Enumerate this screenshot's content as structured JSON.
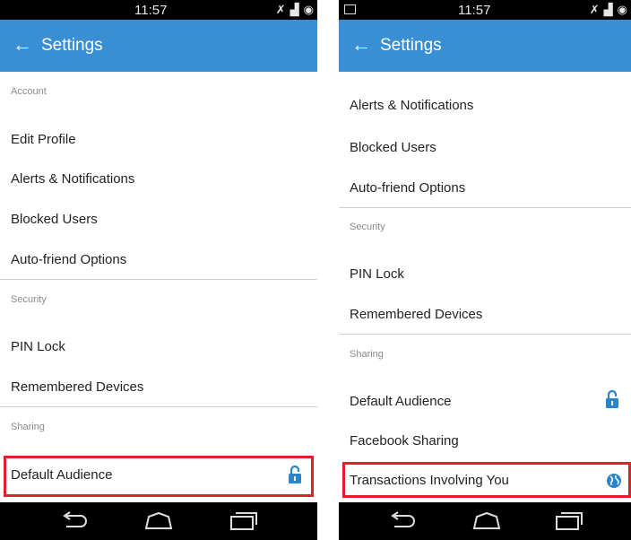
{
  "left": {
    "time": "11:57",
    "title": "Settings",
    "sections": {
      "account": "Account",
      "security": "Security",
      "sharing": "Sharing"
    },
    "items": {
      "edit_profile": "Edit Profile",
      "alerts": "Alerts & Notifications",
      "blocked": "Blocked Users",
      "autofriend": "Auto-friend Options",
      "pin": "PIN Lock",
      "remembered": "Remembered Devices",
      "default_audience": "Default Audience"
    }
  },
  "right": {
    "time": "11:57",
    "title": "Settings",
    "sections": {
      "security": "Security",
      "sharing": "Sharing"
    },
    "items": {
      "alerts": "Alerts & Notifications",
      "blocked": "Blocked Users",
      "autofriend": "Auto-friend Options",
      "pin": "PIN Lock",
      "remembered": "Remembered Devices",
      "default_audience": "Default Audience",
      "facebook": "Facebook Sharing",
      "transactions": "Transactions Involving You"
    }
  },
  "icons": {
    "back": "back-arrow-icon",
    "lock": "lock-icon",
    "globe": "globe-icon",
    "nav_back": "nav-back-icon",
    "nav_home": "nav-home-icon",
    "nav_recents": "nav-recents-icon"
  },
  "colors": {
    "appbar": "#3a8fd4",
    "highlight": "#e0202a",
    "statusbar": "#000000"
  }
}
